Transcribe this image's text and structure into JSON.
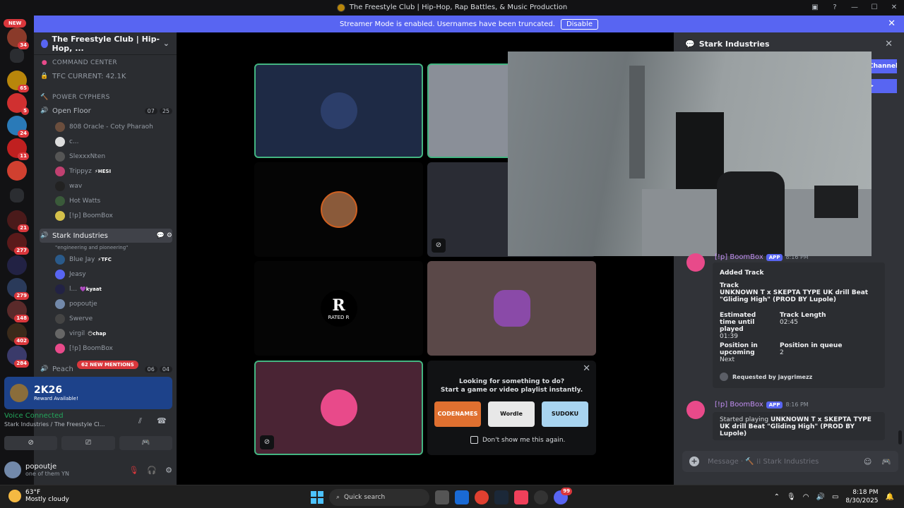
{
  "window": {
    "title": "The Freestyle Club | Hip-Hop, Rap Battles, & Music Production"
  },
  "banner": {
    "text": "Streamer Mode is enabled. Usernames have been truncated.",
    "button": "Disable"
  },
  "guilds": {
    "new_label": "NEW",
    "badges": [
      "34",
      "65",
      "5",
      "24",
      "11",
      "21",
      "277",
      "279",
      "148",
      "402",
      "284"
    ]
  },
  "server": {
    "name": "The Freestyle Club | Hip-Hop, ..."
  },
  "channels": {
    "command_center": "COMMAND CENTER",
    "tfc_current": "TFC CURRENT: 42.1K",
    "power_cyphers": "POWER CYPHERS",
    "open_floor": "Open Floor",
    "open_floor_counts": [
      "07",
      "25"
    ],
    "open_floor_users": [
      {
        "name": "808 Oracle - Coty Pharaoh",
        "tag": "",
        "color": "#6b4e3d"
      },
      {
        "name": "c...",
        "tag": "",
        "color": "#dddddd"
      },
      {
        "name": "SlexxxNten",
        "tag": "",
        "color": "#555555"
      },
      {
        "name": "Trippyz",
        "tag": "⚡HESI",
        "color": "#c04070"
      },
      {
        "name": "wav",
        "tag": "",
        "color": "#222222"
      },
      {
        "name": "Hot Watts",
        "tag": "",
        "color": "#3a5a3a"
      },
      {
        "name": "[!p] BoomBox",
        "tag": "",
        "color": "#d4c04a"
      }
    ],
    "stark": "Stark Industries",
    "stark_status": "\"engineering and pioneering\"",
    "stark_users": [
      {
        "name": "Blue Jay",
        "tag": "⚡TFC",
        "color": "#2a5a8a"
      },
      {
        "name": "Jeasy",
        "tag": "",
        "color": "#5865f2"
      },
      {
        "name": "l...",
        "tag": "💜kyaat",
        "color": "#222244"
      },
      {
        "name": "popoutje",
        "tag": "",
        "color": "#7289aa"
      },
      {
        "name": "Swerve",
        "tag": "",
        "color": "#444444"
      },
      {
        "name": "virgil",
        "tag": "😶chap",
        "color": "#666666"
      },
      {
        "name": "[!p] BoomBox",
        "tag": "",
        "color": "#e84a8a"
      }
    ],
    "peach": "Peach",
    "peach_counts": [
      "06",
      "04"
    ],
    "mentions": "62 NEW MENTIONS"
  },
  "promo": {
    "title": "2K26",
    "subtitle": "Reward Available!"
  },
  "voice": {
    "status": "Voice Connected",
    "location": "Stark Industries / The Freestyle Cl..."
  },
  "user": {
    "name": "popoutje",
    "status": "one of them YN"
  },
  "popup": {
    "line1": "Looking for something to do?",
    "line2": "Start a game or video playlist instantly.",
    "games": [
      "CODENAMES",
      "Wordle",
      "SUDOKU"
    ],
    "checkbox": "Don't show me this again."
  },
  "tiles": {
    "rated_label": "RATED R"
  },
  "right_panel": {
    "channel": "Stark Industries",
    "channel_list_btn": "Channel List",
    "msg1": {
      "author": "[!p] BoomBox",
      "badge": "APP",
      "time": "8:16 PM"
    },
    "embed1": {
      "title": "Added Track",
      "track_label": "Track",
      "track": "UNKNOWN T x SKEPTA TYPE UK drill Beat \"Gliding High\" (PROD BY Lupole)",
      "eta_label": "Estimated time until played",
      "eta": "01:39",
      "length_label": "Track Length",
      "length": "02:45",
      "pos_upcoming_label": "Position in upcoming",
      "pos_upcoming": "Next",
      "pos_queue_label": "Position in queue",
      "pos_queue": "2",
      "requested": "Requested by jaygrimezz"
    },
    "msg2": {
      "author": "[!p] BoomBox",
      "badge": "APP",
      "time": "8:16 PM"
    },
    "embed2": {
      "prefix": "Started playing ",
      "track": "UNKNOWN T x SKEPTA TYPE UK drill Beat \"Gliding High\" (PROD BY Lupole)"
    },
    "composer_placeholder": "Message · 🔨 ⁞⁞ Stark Industries"
  },
  "taskbar": {
    "temp": "63°F",
    "weather": "Mostly cloudy",
    "search": "Quick search",
    "time": "8:18 PM",
    "date": "8/30/2025",
    "discord_badge": "99"
  }
}
